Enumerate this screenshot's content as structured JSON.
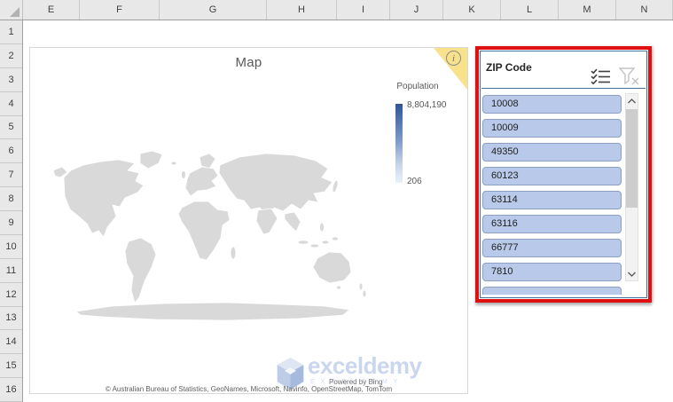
{
  "spreadsheet": {
    "columns": [
      "E",
      "F",
      "G",
      "H",
      "I",
      "J",
      "K",
      "L",
      "M",
      "N"
    ],
    "rows": [
      "1",
      "2",
      "3",
      "4",
      "5",
      "6",
      "7",
      "8",
      "9",
      "10",
      "11",
      "12",
      "13",
      "14",
      "15",
      "16"
    ]
  },
  "chart": {
    "title": "Map",
    "info_label": "i",
    "legend": {
      "title": "Population",
      "max": "8,804,190",
      "min": "206"
    },
    "attribution": "© Australian Bureau of Statistics, GeoNames, Microsoft, Navinfo, OpenStreetMap, TomTom",
    "watermark": {
      "brand": "exceldemy",
      "sub": "E X C E L D E M Y",
      "powered": "Powered by Bing"
    }
  },
  "slicer": {
    "title": "ZIP Code",
    "items": [
      "10008",
      "10009",
      "49350",
      "60123",
      "63114",
      "63116",
      "66777",
      "7810"
    ]
  },
  "chart_data": {
    "type": "map",
    "title": "Map",
    "series": [
      {
        "name": "Population",
        "min": 206,
        "max": 8804190
      }
    ],
    "legend_position": "right",
    "legend_gradient": [
      "#2f5597",
      "#eaf1fa"
    ]
  },
  "colors": {
    "annotation_red": "#e01010",
    "slicer_border": "#41719c",
    "slicer_item_fill": "#b9c9e9",
    "info_triangle": "#f8e38c",
    "map_land": "#d9d9d9"
  }
}
